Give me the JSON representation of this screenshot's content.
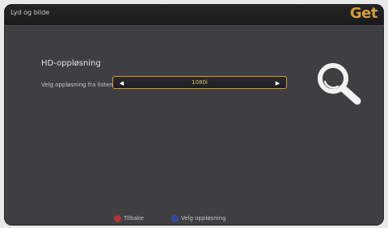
{
  "header": {
    "title": "Lyd og bilde",
    "logo": "Get"
  },
  "setting": {
    "title": "HD-oppløsning",
    "description": "Velg oppløsning fra listen",
    "value": "1080i",
    "left_icon": "arrow-left-icon",
    "right_icon": "arrow-right-icon"
  },
  "decoration": {
    "icon": "magnifier-icon"
  },
  "footer": {
    "items": [
      {
        "label": "Tilbake",
        "color": "#c52a2a",
        "icon": "red-button-icon"
      },
      {
        "label": "Velg oppløsning",
        "color": "#2d49b0",
        "icon": "blue-button-icon"
      }
    ]
  }
}
